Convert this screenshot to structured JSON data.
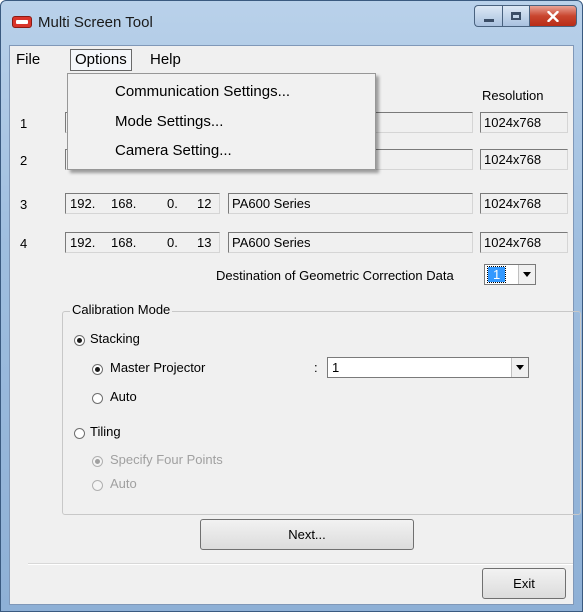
{
  "window": {
    "title": "Multi Screen Tool",
    "icon": "app-icon"
  },
  "menubar": {
    "items": [
      {
        "label": "File"
      },
      {
        "label": "Options"
      },
      {
        "label": "Help"
      }
    ]
  },
  "options_menu": {
    "items": [
      {
        "label": "Communication Settings..."
      },
      {
        "label": "Mode Settings..."
      },
      {
        "label": "Camera Setting..."
      }
    ]
  },
  "table": {
    "resolution_header": "Resolution",
    "rows": [
      {
        "num": "1",
        "ip": [
          "",
          "",
          "",
          ""
        ],
        "model": "",
        "resolution": "1024x768"
      },
      {
        "num": "2",
        "ip": [
          "",
          "",
          "",
          ""
        ],
        "model": "",
        "resolution": "1024x768"
      },
      {
        "num": "3",
        "ip": [
          "192.",
          "168.",
          "0.",
          "12"
        ],
        "model": "PA600 Series",
        "resolution": "1024x768"
      },
      {
        "num": "4",
        "ip": [
          "192.",
          "168.",
          "0.",
          "13"
        ],
        "model": "PA600 Series",
        "resolution": "1024x768"
      }
    ]
  },
  "destination": {
    "label": "Destination of Geometric Correction Data",
    "value": "1"
  },
  "calibration": {
    "title": "Calibration Mode",
    "stacking": {
      "label": "Stacking",
      "selected": true
    },
    "master_projector": {
      "label": "Master Projector",
      "colon": ":",
      "value": "1",
      "selected": true
    },
    "stacking_auto": {
      "label": "Auto",
      "selected": false
    },
    "tiling": {
      "label": "Tiling",
      "selected": false
    },
    "specify_four_points": {
      "label": "Specify Four Points",
      "selected": true,
      "disabled": true
    },
    "tiling_auto": {
      "label": "Auto",
      "selected": false,
      "disabled": true
    }
  },
  "buttons": {
    "next": "Next...",
    "exit": "Exit"
  },
  "colors": {
    "title_bar": "#b9d1ea",
    "close_button": "#c9462f",
    "selection": "#3399ff",
    "dialog": "#f0f0f0"
  }
}
